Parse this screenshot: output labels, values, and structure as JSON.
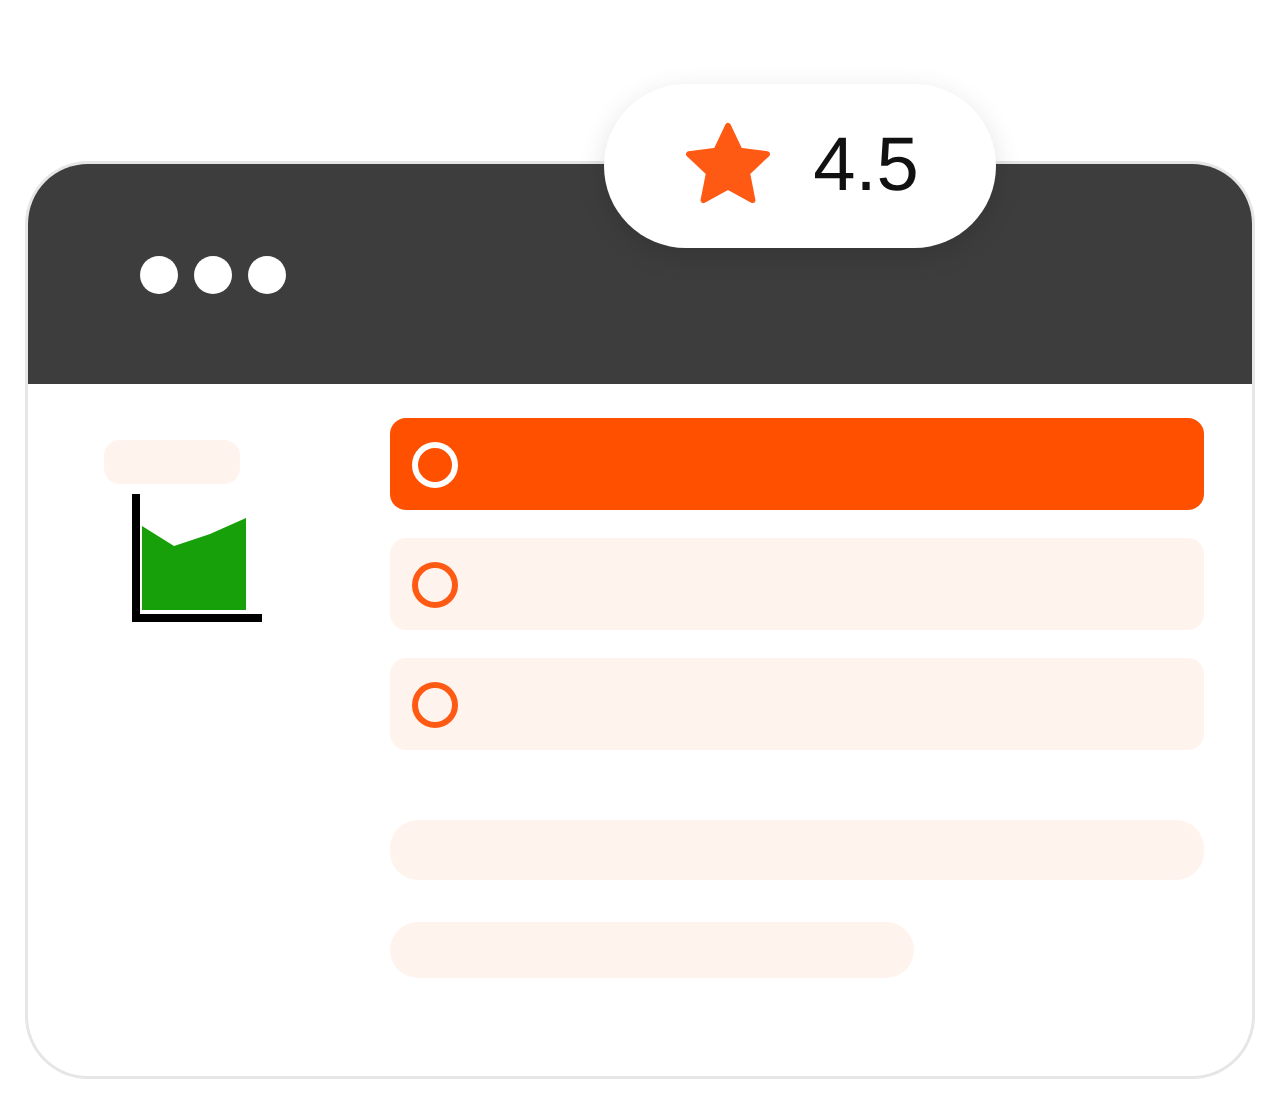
{
  "rating": {
    "value": "4.5"
  },
  "options": [
    {
      "selected": true
    },
    {
      "selected": false
    },
    {
      "selected": false
    }
  ]
}
